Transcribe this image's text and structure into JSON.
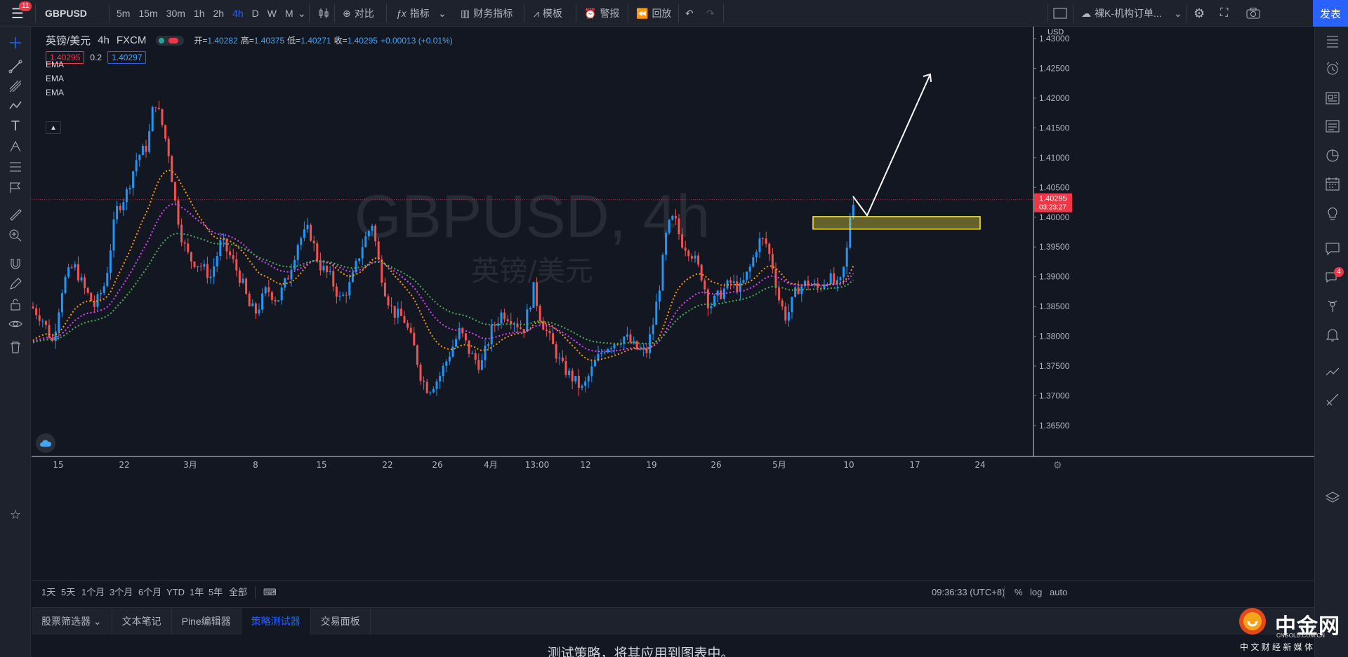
{
  "topbar": {
    "notification_count": "11",
    "symbol": "GBPUSD",
    "intervals": [
      "5m",
      "15m",
      "30m",
      "1h",
      "2h",
      "4h",
      "D",
      "W",
      "M"
    ],
    "active_interval": "4h",
    "compare_label": "对比",
    "indicators_label": "指标",
    "financials_label": "财务指标",
    "templates_label": "模板",
    "alert_label": "警报",
    "replay_label": "回放",
    "layout_name": "裸K-机构订单...",
    "publish_label": "发表"
  },
  "legend": {
    "name": "英镑/美元",
    "timeframe": "4h",
    "source": "FXCM",
    "open_label": "开=",
    "open": "1.40282",
    "high_label": "高=",
    "high": "1.40375",
    "low_label": "低=",
    "low": "1.40271",
    "close_label": "收=",
    "close": "1.40295",
    "change": "+0.00013 (+0.01%)",
    "bid": "1.40295",
    "spread": "0.2",
    "ask": "1.40297",
    "ema_labels": [
      "EMA",
      "EMA",
      "EMA"
    ]
  },
  "watermark": {
    "line1": "GBPUSD, 4h",
    "line2": "英镑/美元"
  },
  "price_axis": {
    "currency": "USD",
    "ticks": [
      "1.43000",
      "1.42500",
      "1.42000",
      "1.41500",
      "1.41000",
      "1.40500",
      "1.40000",
      "1.39500",
      "1.39000",
      "1.38500",
      "1.38000",
      "1.37500",
      "1.37000",
      "1.36500"
    ],
    "last_price": "1.40295",
    "countdown": "03:23:27"
  },
  "time_axis": {
    "ticks": [
      "15",
      "22",
      "3月",
      "8",
      "15",
      "22",
      "26",
      "4月",
      "13:00",
      "12",
      "19",
      "26",
      "5月",
      "10",
      "17",
      "24"
    ]
  },
  "colors": {
    "up": "#2196f3",
    "down": "#f05350",
    "ema_fast": "#ff9800",
    "ema_mid": "#e040fb",
    "ema_slow": "#4caf50",
    "zone": "#ffeb3b"
  },
  "rangebar": {
    "ranges": [
      "1天",
      "5天",
      "1个月",
      "3个月",
      "6个月",
      "YTD",
      "1年",
      "5年",
      "全部"
    ],
    "clock": "09:36:33 (UTC+8)",
    "pct": "%",
    "log": "log",
    "auto": "auto"
  },
  "bottom_tabs": [
    "股票筛选器",
    "文本笔记",
    "Pine编辑器",
    "策略测试器",
    "交易面板"
  ],
  "active_bottom_tab": "策略测试器",
  "bottom_message": "测试策略，将其应用到图表中。",
  "right_badge": "4",
  "logo": {
    "name": "中金网",
    "domain": "CNGOLD.COM.CN",
    "tagline": "中 文 财 经 新 媒 体"
  }
}
